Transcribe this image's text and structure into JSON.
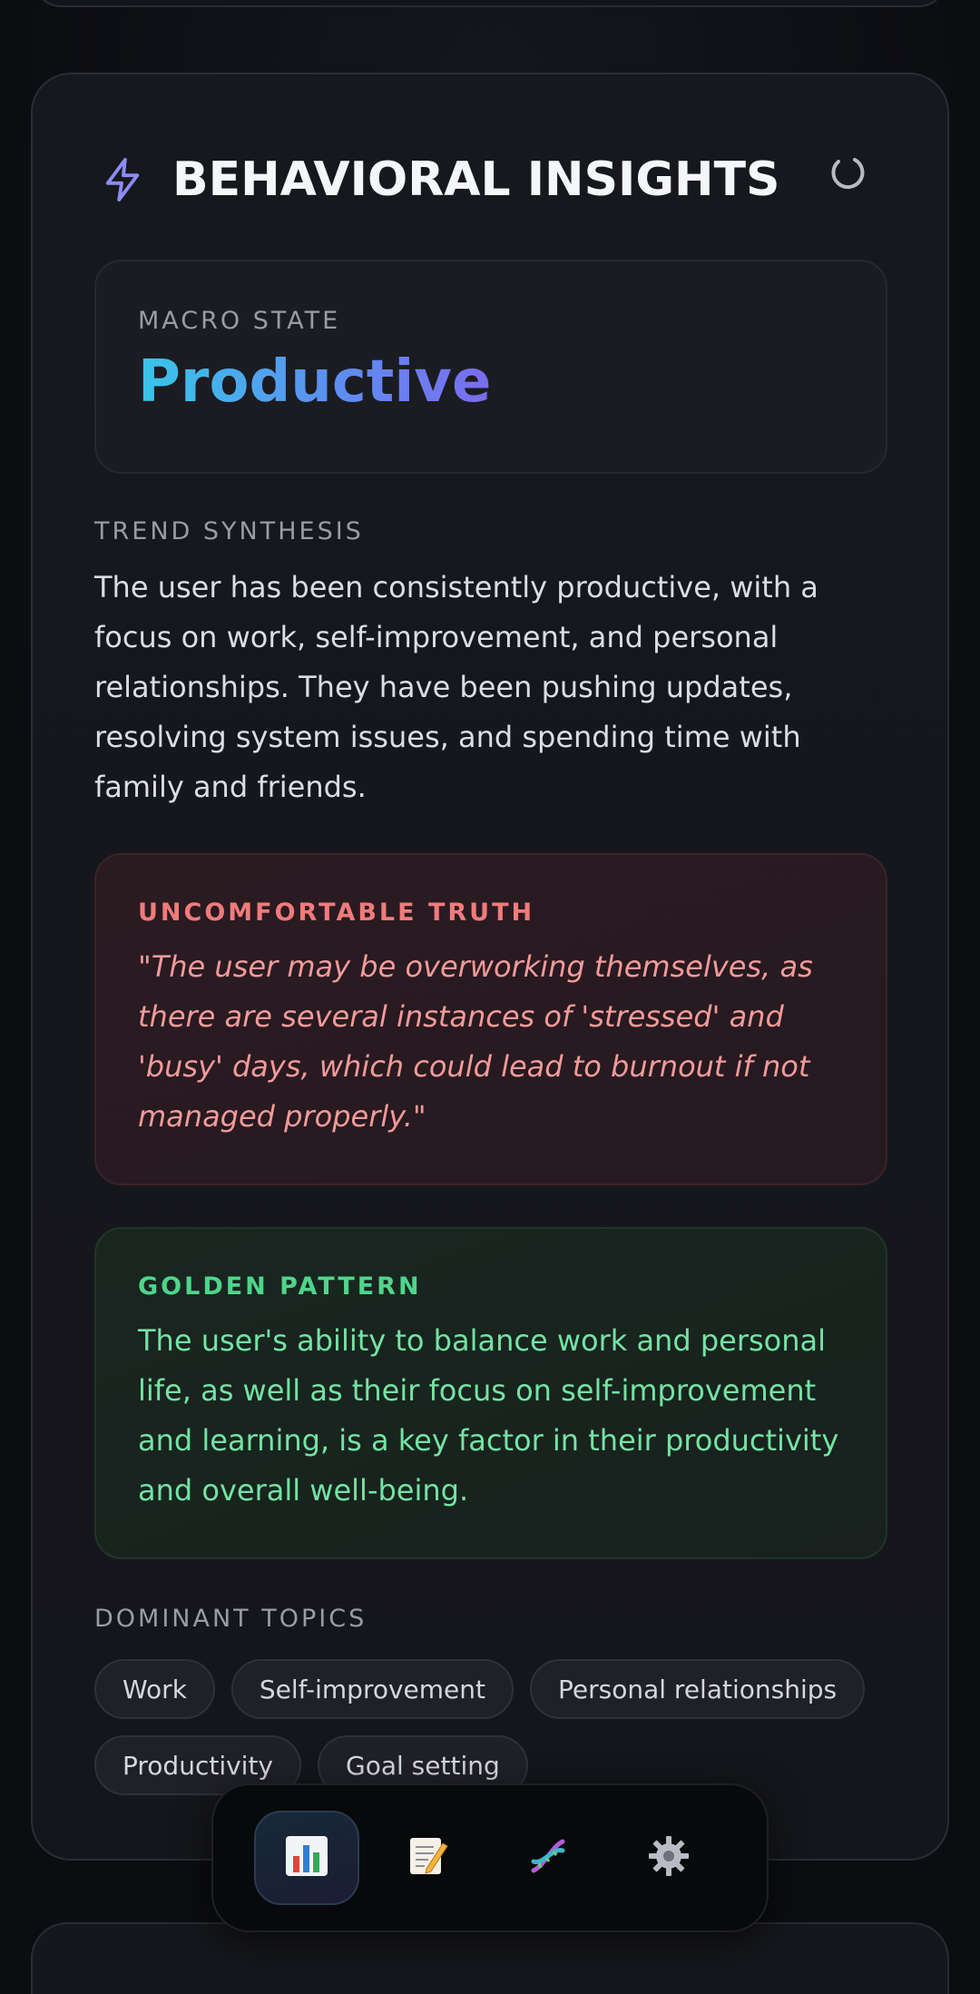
{
  "card": {
    "title": "BEHAVIORAL INSIGHTS",
    "title_icon": "lightning-bolt-icon",
    "refresh_icon": "refresh-icon"
  },
  "macro_state": {
    "label": "MACRO STATE",
    "value": "Productive"
  },
  "trend_synthesis": {
    "label": "TREND SYNTHESIS",
    "text": "The user has been consistently productive, with a focus on work, self-improvement, and personal relationships. They have been pushing updates, resolving system issues, and spending time with family and friends."
  },
  "uncomfortable_truth": {
    "label": "UNCOMFORTABLE TRUTH",
    "text": "\"The user may be overworking themselves, as there are several instances of 'stressed' and 'busy' days, which could lead to burnout if not managed properly.\""
  },
  "golden_pattern": {
    "label": "GOLDEN PATTERN",
    "text": "The user's ability to balance work and personal life, as well as their focus on self-improvement and learning, is a key factor in their productivity and overall well-being."
  },
  "dominant_topics": {
    "label": "DOMINANT TOPICS",
    "items": [
      "Work",
      "Self-improvement",
      "Personal relationships",
      "Productivity",
      "Goal setting"
    ]
  },
  "bottom_nav": {
    "items": [
      {
        "icon": "bar-chart-icon",
        "active": true
      },
      {
        "icon": "memo-icon",
        "active": false
      },
      {
        "icon": "dna-icon",
        "active": false
      },
      {
        "icon": "gear-icon",
        "active": false
      }
    ]
  },
  "colors": {
    "accent_gradient_start": "#38c6e8",
    "accent_gradient_end": "#7a6cf0",
    "truth_red": "#f07b7b",
    "golden_green": "#4fd58a",
    "icon_purple": "#8b8cf5"
  }
}
